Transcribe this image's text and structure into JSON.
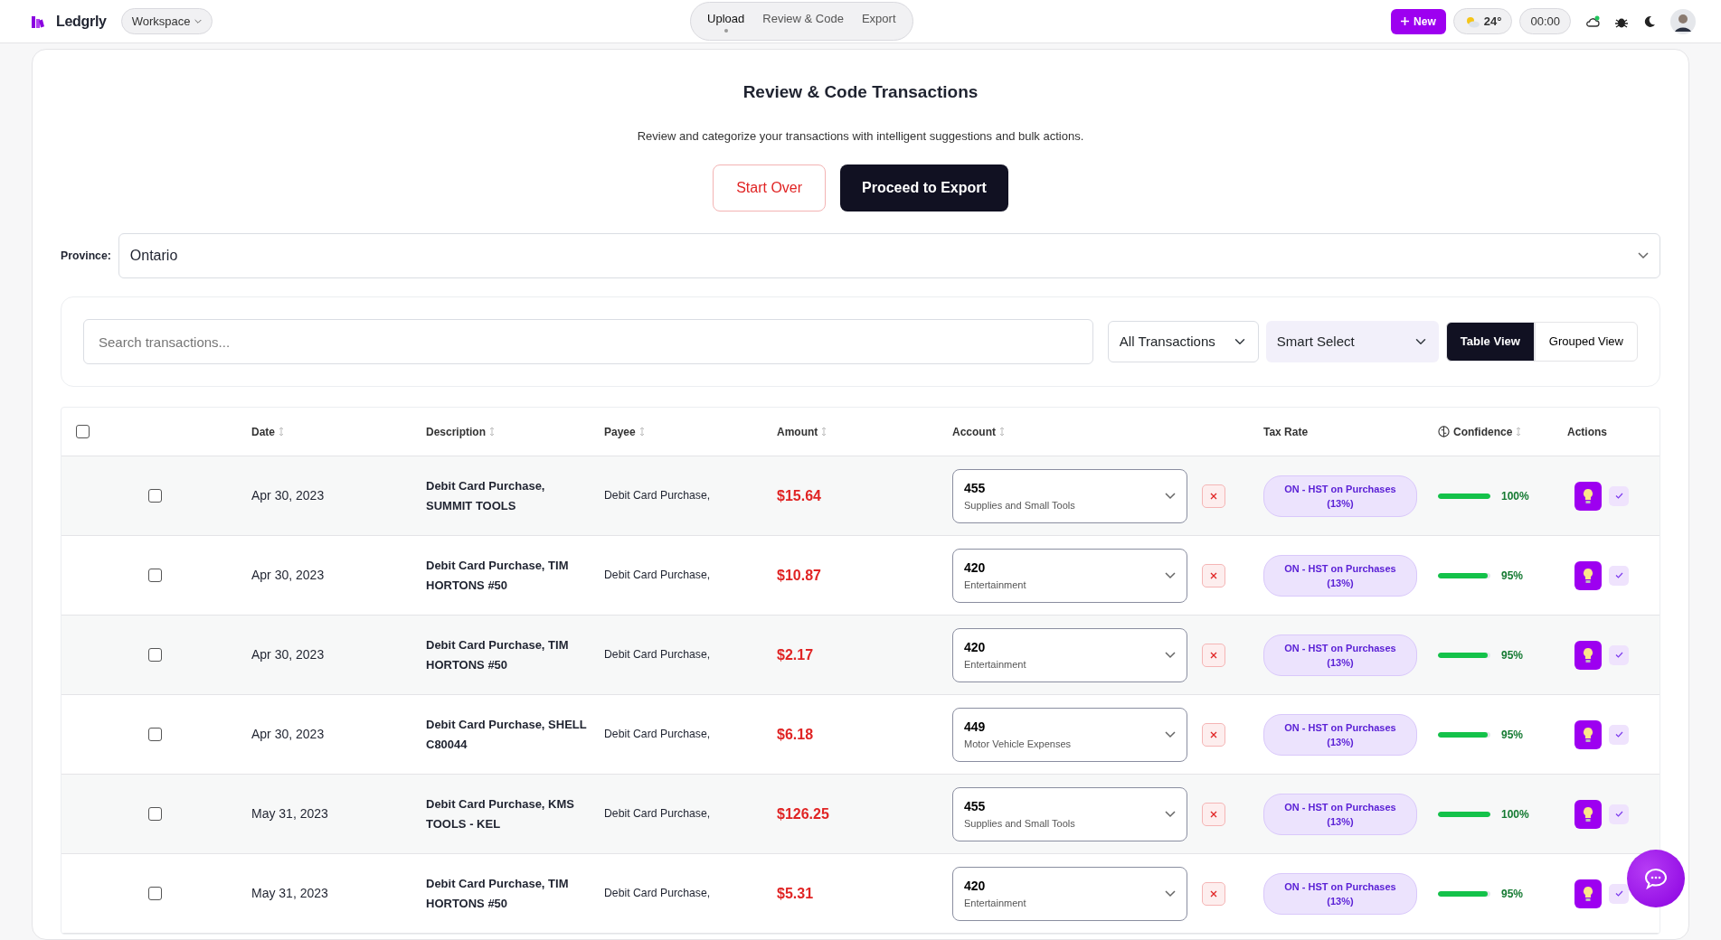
{
  "brand": "Ledgrly",
  "workspace": "Workspace",
  "nav_tabs": [
    {
      "label": "Upload",
      "selected": true
    },
    {
      "label": "Review & Code",
      "selected": false
    },
    {
      "label": "Export",
      "selected": false
    }
  ],
  "new_button": "New",
  "weather": "24°",
  "timer": "00:00",
  "title": "Review & Code Transactions",
  "subtitle": "Review and categorize your transactions with intelligent suggestions and bulk actions.",
  "start_over": "Start Over",
  "proceed": "Proceed to Export",
  "province": {
    "label": "Province:",
    "value": "Ontario"
  },
  "search": {
    "placeholder": "Search transactions..."
  },
  "filter_select": "All Transactions",
  "smart_select": "Smart Select",
  "views": [
    {
      "label": "Table View",
      "selected": true
    },
    {
      "label": "Grouped View",
      "selected": false
    }
  ],
  "select_all": false,
  "columns": [
    {
      "label": "Date",
      "sortable": true
    },
    {
      "label": "Description",
      "sortable": true
    },
    {
      "label": "Payee",
      "sortable": true
    },
    {
      "label": "Amount",
      "sortable": true
    },
    {
      "label": "Account",
      "sortable": true
    },
    {
      "label": "Tax Rate",
      "sortable": false
    },
    {
      "label": "Confidence",
      "sortable": true
    },
    {
      "label": "Actions",
      "sortable": false
    }
  ],
  "rows": [
    {
      "checked": false,
      "date": "Apr 30, 2023",
      "description": "Debit Card Purchase, SUMMIT TOOLS",
      "payee": "Debit Card Purchase,",
      "amount": "$15.64",
      "account_code": "455",
      "account_name": "Supplies and Small Tools",
      "tax": "ON - HST on Purchases (13%)",
      "level": 1.0,
      "confidence": "100%"
    },
    {
      "checked": false,
      "date": "Apr 30, 2023",
      "description": "Debit Card Purchase, TIM HORTONS #50",
      "payee": "Debit Card Purchase,",
      "amount": "$10.87",
      "account_code": "420",
      "account_name": "Entertainment",
      "tax": "ON - HST on Purchases (13%)",
      "level": 0.95,
      "confidence": "95%"
    },
    {
      "checked": false,
      "date": "Apr 30, 2023",
      "description": "Debit Card Purchase, TIM HORTONS #50",
      "payee": "Debit Card Purchase,",
      "amount": "$2.17",
      "account_code": "420",
      "account_name": "Entertainment",
      "tax": "ON - HST on Purchases (13%)",
      "level": 0.95,
      "confidence": "95%"
    },
    {
      "checked": false,
      "date": "Apr 30, 2023",
      "description": "Debit Card Purchase, SHELL C80044",
      "payee": "Debit Card Purchase,",
      "amount": "$6.18",
      "account_code": "449",
      "account_name": "Motor Vehicle Expenses",
      "tax": "ON - HST on Purchases (13%)",
      "level": 0.95,
      "confidence": "95%"
    },
    {
      "checked": false,
      "date": "May 31, 2023",
      "description": "Debit Card Purchase, KMS TOOLS - KEL",
      "payee": "Debit Card Purchase,",
      "amount": "$126.25",
      "account_code": "455",
      "account_name": "Supplies and Small Tools",
      "tax": "ON - HST on Purchases (13%)",
      "level": 1.0,
      "confidence": "100%"
    },
    {
      "checked": false,
      "date": "May 31, 2023",
      "description": "Debit Card Purchase, TIM HORTONS #50",
      "payee": "Debit Card Purchase,",
      "amount": "$5.31",
      "account_code": "420",
      "account_name": "Entertainment",
      "tax": "ON - HST on Purchases (13%)",
      "level": 0.95,
      "confidence": "95%"
    }
  ]
}
